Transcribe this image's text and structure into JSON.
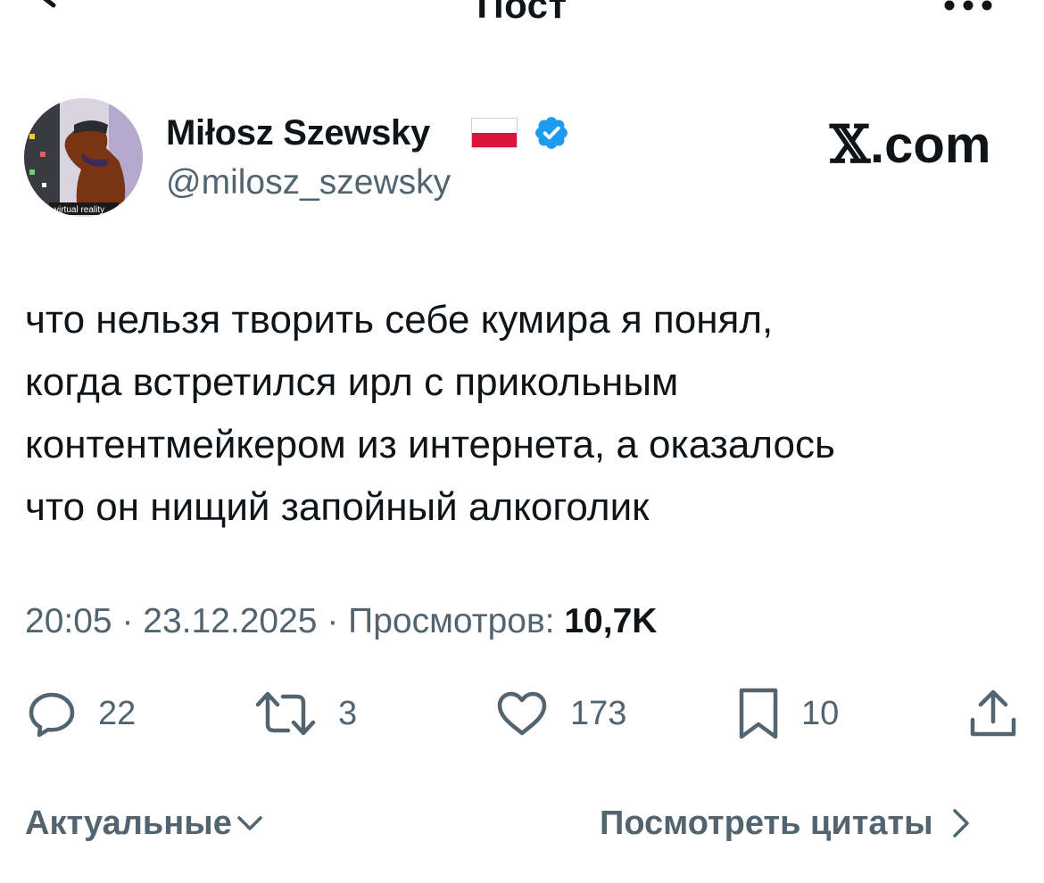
{
  "header": {
    "title": "Пост",
    "back_icon": "arrow-left-icon",
    "more_icon": "more-horizontal-icon"
  },
  "author": {
    "name": "Miłosz Szewsky",
    "handle": "@milosz_szewsky",
    "avatar_caption": "virtual reality",
    "flag": "poland-flag-icon",
    "verified_icon": "verified-badge-icon",
    "verified_color": "#1d9bf0"
  },
  "brand": {
    "x": "𝕏",
    "suffix": ".com"
  },
  "tweet": {
    "text": "что нельзя творить себе кумира я понял,\nкогда встретился ирл с прикольным\nконтентмейкером из интернета, а оказалось\nчто он нищий запойный алкоголик"
  },
  "meta": {
    "time": "20:05",
    "sep": " · ",
    "date": "23.12.2025",
    "views_label": "Просмотров: ",
    "views": "10,7K"
  },
  "actions": {
    "replies": "22",
    "retweets": "3",
    "likes": "173",
    "bookmarks": "10"
  },
  "footer": {
    "relevant": "Актуальные",
    "quotes": "Посмотреть цитаты"
  },
  "colors": {
    "text": "#0f1419",
    "secondary": "#536471"
  }
}
